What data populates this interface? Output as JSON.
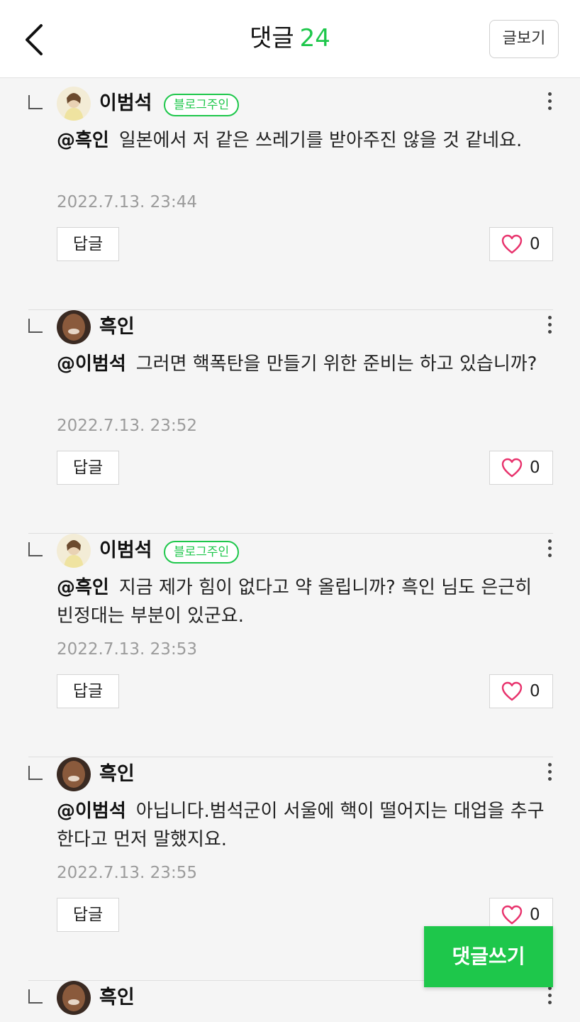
{
  "header": {
    "title": "댓글",
    "count": "24",
    "view_post_label": "글보기"
  },
  "comments": [
    {
      "author": "이범석",
      "badge": "블로그주인",
      "mention": "@흑인",
      "text": "일본에서 저 같은 쓰레기를 받아주진 않을 것 같네요.",
      "time": "2022.7.13. 23:44",
      "reply_label": "답글",
      "likes": "0"
    },
    {
      "author": "흑인",
      "mention": "@이범석",
      "text": "그러면 핵폭탄을 만들기 위한 준비는 하고 있습니까?",
      "time": "2022.7.13. 23:52",
      "reply_label": "답글",
      "likes": "0"
    },
    {
      "author": "이범석",
      "badge": "블로그주인",
      "mention": "@흑인",
      "text": "지금 제가 힘이 없다고 약 올립니까? 흑인 님도 은근히 빈정대는 부분이 있군요.",
      "time": "2022.7.13. 23:53",
      "reply_label": "답글",
      "likes": "0"
    },
    {
      "author": "흑인",
      "mention": "@이범석",
      "text": "아닙니다.범석군이 서울에 핵이 떨어지는 대업을 추구한다고 먼저 말했지요.",
      "time": "2022.7.13. 23:55",
      "reply_label": "답글",
      "likes": "0"
    },
    {
      "author": "흑인"
    }
  ],
  "write_button_label": "댓글쓰기",
  "colors": {
    "accent": "#1ec74b",
    "heart": "#e8336d",
    "timestamp": "#9b9b9b"
  }
}
